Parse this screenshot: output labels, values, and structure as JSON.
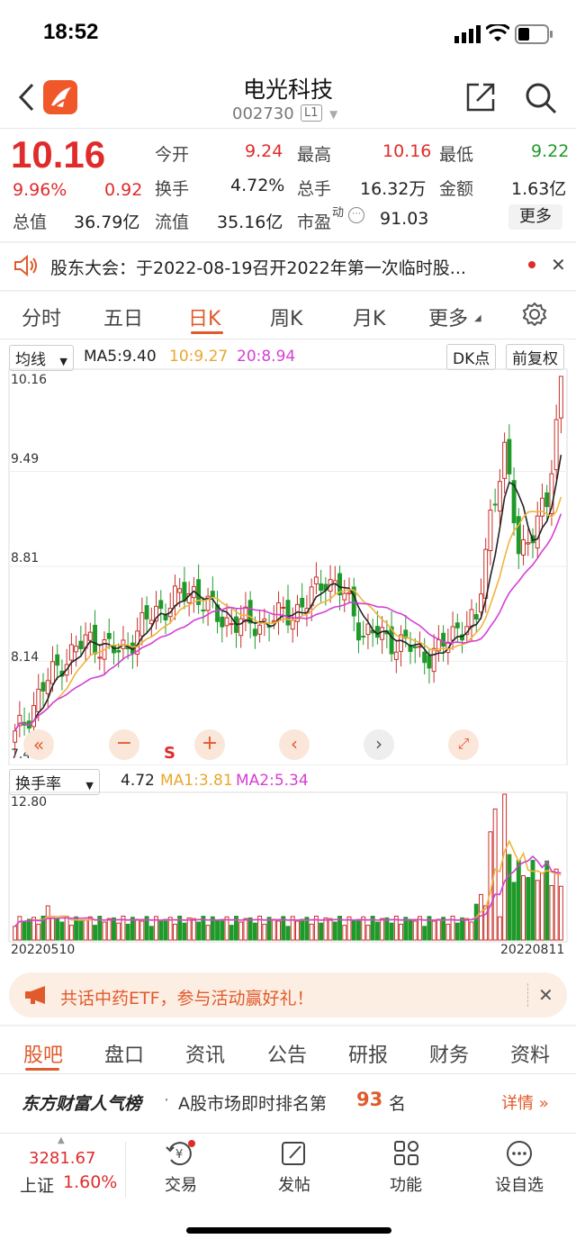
{
  "status_bar": {
    "time": "18:52"
  },
  "header": {
    "title": "电光科技",
    "code": "002730",
    "level": "L1"
  },
  "quote": {
    "price": "10.16",
    "change_pct": "9.96%",
    "change": "0.92",
    "today_open_label": "今开",
    "today_open": "9.24",
    "high_label": "最高",
    "high": "10.16",
    "low_label": "最低",
    "low": "9.22",
    "turnover_label": "换手",
    "turnover": "4.72%",
    "volume_label": "总手",
    "volume": "16.32万",
    "amount_label": "金额",
    "amount": "1.63亿",
    "mktcap_label": "总值",
    "mktcap": "36.79亿",
    "float_label": "流值",
    "float_cap": "35.16亿",
    "pe_label": "市盈",
    "pe_sup": "动",
    "pe": "91.03",
    "more_label": "更多"
  },
  "notice": {
    "text": "股东大会：于2022-08-19召开2022年第一次临时股..."
  },
  "period_tabs": [
    "分时",
    "五日",
    "日K",
    "周K",
    "月K",
    "更多"
  ],
  "active_period": "日K",
  "kline": {
    "indicator": "均线",
    "ma5": "MA5:9.40",
    "ma10": "10:9.27",
    "ma20": "20:8.94",
    "dk_label": "DK点",
    "adjust_label": "前复权",
    "y_labels": [
      "10.16",
      "9.49",
      "8.81",
      "8.14",
      "7.47"
    ],
    "marker_s": "S"
  },
  "volume_panel": {
    "indicator": "换手率",
    "value": "4.72",
    "ma1": "MA1:3.81",
    "ma2": "MA2:5.34",
    "y_top": "12.80",
    "date_start": "20220510",
    "date_end": "20220811"
  },
  "chart_data": {
    "type": "candlestick",
    "y_range": [
      7.47,
      10.16
    ],
    "start_date": "20220510",
    "end_date": "20220811",
    "last_close": 10.16,
    "ma": {
      "ma5": 9.4,
      "ma10": 9.27,
      "ma20": 8.94
    },
    "turnover_range": [
      0,
      12.8
    ],
    "last_turnover": 4.72
  },
  "colors": {
    "up": "#c8302b",
    "down": "#1f9a2a",
    "accent": "#e05a2b",
    "ma5": "#222222",
    "ma10": "#f0b43c",
    "ma20": "#d43fd4"
  },
  "banner": {
    "text": "共话中药ETF，参与活动赢好礼！"
  },
  "bottom_tabs": [
    "股吧",
    "盘口",
    "资讯",
    "公告",
    "研报",
    "财务",
    "资料"
  ],
  "ranking": {
    "brand": "东方财富人气榜",
    "text": "A股市场即时排名第",
    "rank": "93",
    "unit": "名",
    "details": "详情"
  },
  "bottom_nav": {
    "index_value": "3281.67",
    "index_name": "上证",
    "index_change": "1.60%",
    "trade": "交易",
    "post": "发帖",
    "features": "功能",
    "watchlist": "设自选"
  }
}
